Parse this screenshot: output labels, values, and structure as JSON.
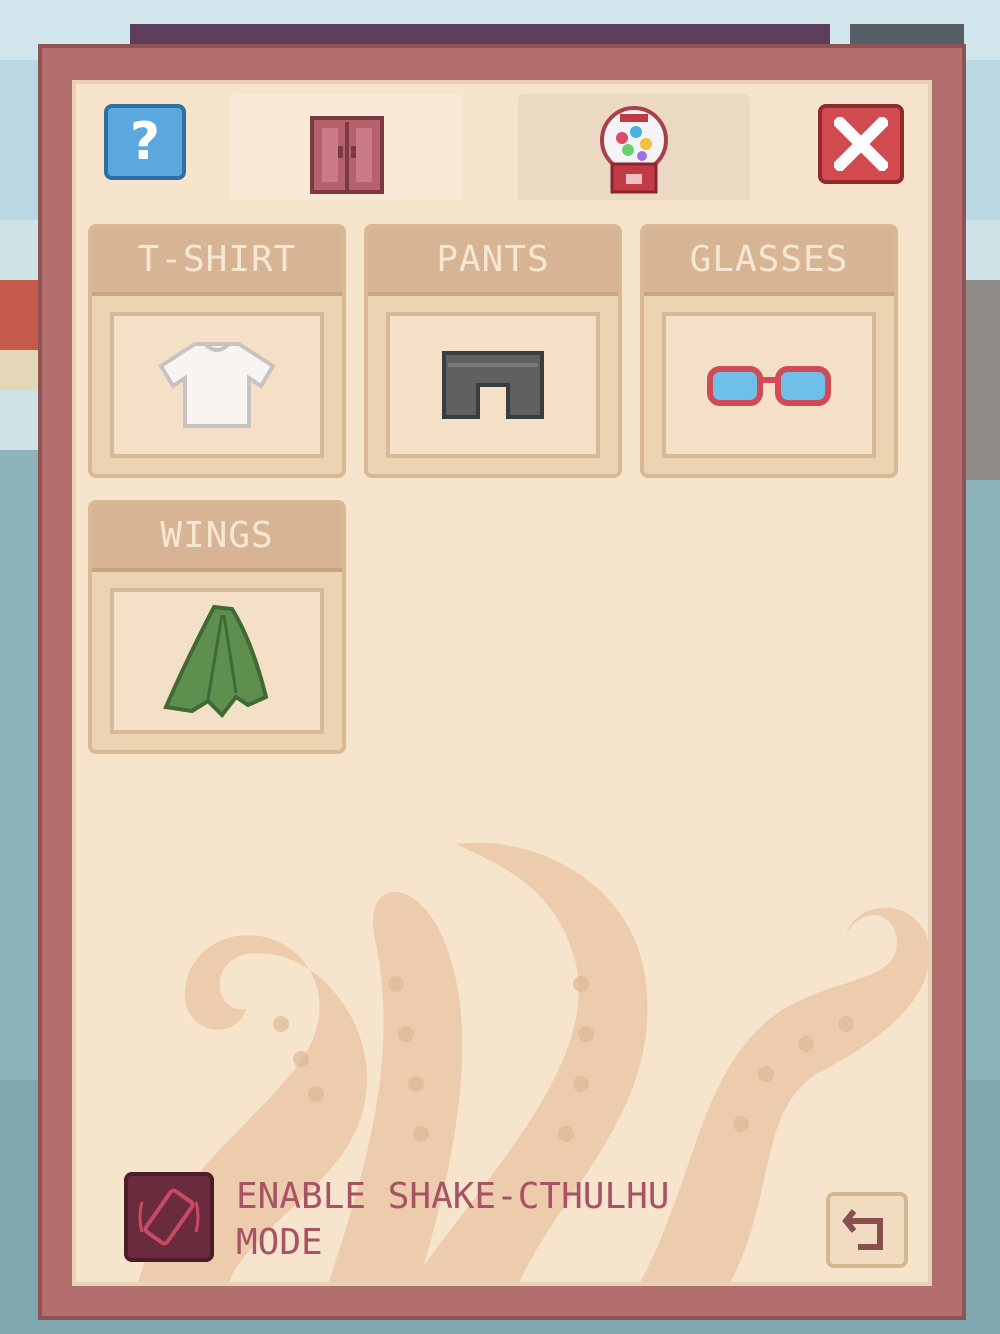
{
  "colors": {
    "modal_frame": "#b36e6e",
    "panel_bg": "#f6e4cc",
    "slot_header": "#d7b594",
    "close_red": "#d14a4f",
    "help_blue": "#5ba8df",
    "shake_text": "#a85266"
  },
  "tabs": [
    {
      "icon": "wardrobe-icon",
      "selected": true
    },
    {
      "icon": "gacha-machine-icon",
      "selected": false
    }
  ],
  "help": {
    "icon_text": "?"
  },
  "slots": [
    {
      "label": "T-SHIRT",
      "item": "white-tshirt-icon"
    },
    {
      "label": "PANTS",
      "item": "gray-pants-icon"
    },
    {
      "label": "GLASSES",
      "item": "red-glasses-icon"
    },
    {
      "label": "WINGS",
      "item": "green-wings-icon"
    }
  ],
  "shake": {
    "line1": "ENABLE SHAKE-CTHULHU",
    "line2": "MODE",
    "icon": "shake-phone-icon"
  },
  "back": {
    "icon": "undo-arrow-icon"
  }
}
